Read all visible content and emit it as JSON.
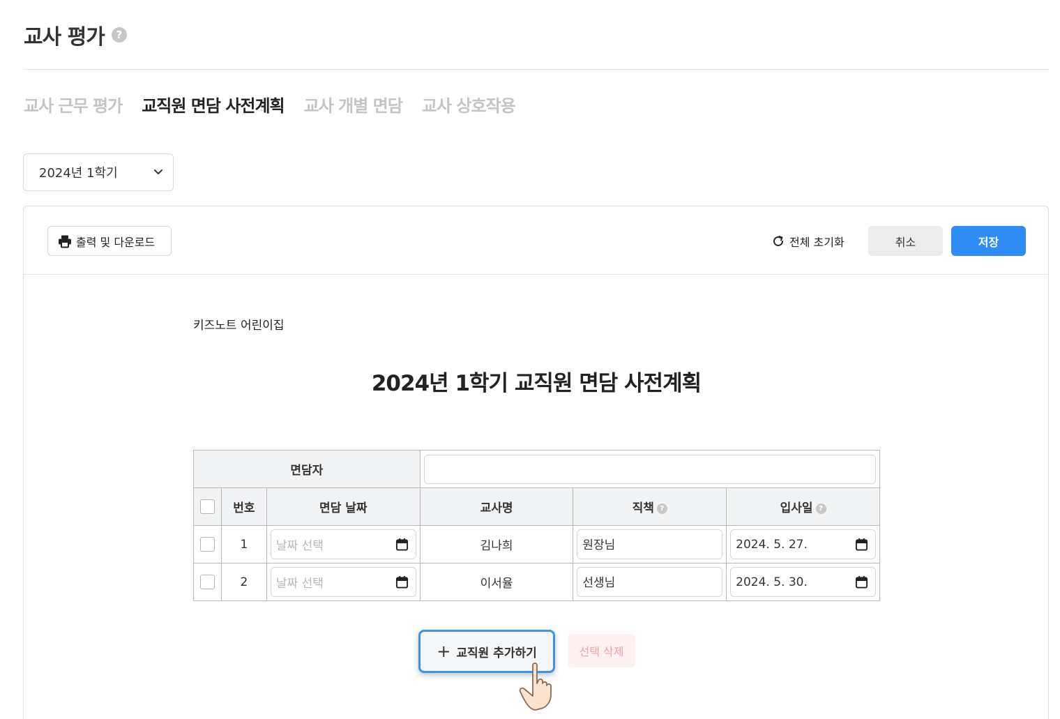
{
  "header": {
    "title": "교사 평가",
    "help_glyph": "?"
  },
  "tabs": [
    {
      "label": "교사 근무 평가",
      "active": false
    },
    {
      "label": "교직원 면담 사전계획",
      "active": true
    },
    {
      "label": "교사 개별 면담",
      "active": false
    },
    {
      "label": "교사 상호작용",
      "active": false
    }
  ],
  "term_select": {
    "value": "2024년 1학기",
    "icon": "chevron-down-icon"
  },
  "toolbar": {
    "print_label": "출력 및 다운로드",
    "reset_label": "전체 초기화",
    "cancel_label": "취소",
    "save_label": "저장"
  },
  "document": {
    "org_name": "키즈노트 어린이집",
    "title": "2024년 1학기 교직원 면담 사전계획",
    "interviewer_label": "면담자",
    "interviewer_value": "",
    "columns": [
      "번호",
      "면담 날짜",
      "교사명",
      "직책",
      "입사일"
    ],
    "rows": [
      {
        "no": "1",
        "date_placeholder": "날짜 선택",
        "teacher": "김나희",
        "position": "원장님",
        "hire_date": "2024. 5. 27."
      },
      {
        "no": "2",
        "date_placeholder": "날짜 선택",
        "teacher": "이서율",
        "position": "선생님",
        "hire_date": "2024. 5. 30."
      }
    ]
  },
  "actions": {
    "add_label": "교직원 추가하기",
    "add_icon": "+",
    "delete_label": "선택 삭제"
  },
  "colors": {
    "accent": "#2e8df5",
    "header_bg": "#f1f3f5",
    "delete_text": "#f3a2a2",
    "delete_bg": "#fdf1f1"
  }
}
